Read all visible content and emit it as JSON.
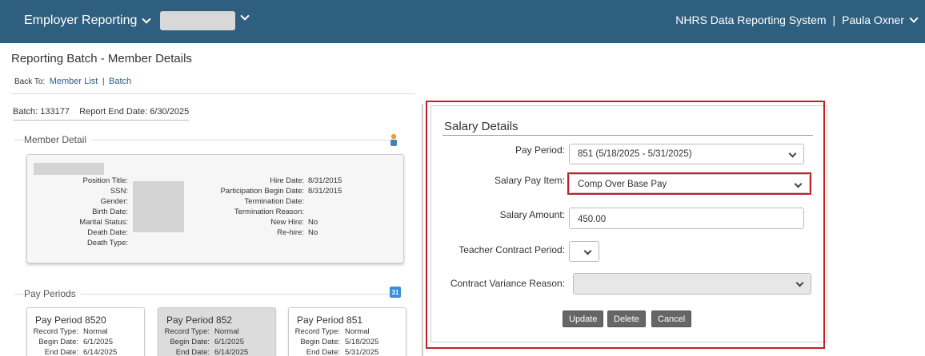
{
  "header": {
    "menu_label": "Employer Reporting",
    "system_name": "NHRS Data Reporting System",
    "separator": "|",
    "user_name": "Paula Oxner"
  },
  "page": {
    "title": "Reporting Batch - Member Details",
    "back_to_label": "Back To:",
    "back_member_list": "Member List",
    "back_sep": "|",
    "back_batch": "Batch"
  },
  "batch": {
    "batch_label": "Batch:",
    "batch_number": "133177",
    "report_end_label": "Report End Date:",
    "report_end_date": "6/30/2025"
  },
  "member_detail": {
    "heading": "Member Detail",
    "left_fields": [
      {
        "label": "Position Title:",
        "value": ""
      },
      {
        "label": "SSN:",
        "value": ""
      },
      {
        "label": "Gender:",
        "value": ""
      },
      {
        "label": "Birth Date:",
        "value": ""
      },
      {
        "label": "Marital Status:",
        "value": ""
      },
      {
        "label": "Death Date:",
        "value": ""
      },
      {
        "label": "Death Type:",
        "value": ""
      }
    ],
    "right_fields": [
      {
        "label": "Hire Date:",
        "value": "8/31/2015"
      },
      {
        "label": "Participation Begin Date:",
        "value": "8/31/2015"
      },
      {
        "label": "Termination Date:",
        "value": ""
      },
      {
        "label": "Termination Reason:",
        "value": ""
      },
      {
        "label": "New Hire:",
        "value": "No"
      },
      {
        "label": "Re-hire:",
        "value": "No"
      }
    ]
  },
  "pay_periods": {
    "heading": "Pay Periods",
    "calendar_glyph": "31",
    "cards": [
      {
        "title": "Pay Period 8520",
        "record_type_label": "Record Type:",
        "record_type": "Normal",
        "begin_label": "Begin Date:",
        "begin": "6/1/2025",
        "end_label": "End Date:",
        "end": "6/14/2025",
        "selected": false
      },
      {
        "title": "Pay Period 852",
        "record_type_label": "Record Type:",
        "record_type": "Normal",
        "begin_label": "Begin Date:",
        "begin": "6/1/2025",
        "end_label": "End Date:",
        "end": "6/14/2025",
        "selected": true
      },
      {
        "title": "Pay Period 851",
        "record_type_label": "Record Type:",
        "record_type": "Normal",
        "begin_label": "Begin Date:",
        "begin": "5/18/2025",
        "end_label": "End Date:",
        "end": "5/31/2025",
        "selected": false
      }
    ]
  },
  "salary_details": {
    "heading": "Salary Details",
    "pay_period_label": "Pay Period:",
    "pay_period_value": "851 (5/18/2025 - 5/31/2025)",
    "salary_pay_item_label": "Salary Pay Item:",
    "salary_pay_item_value": "Comp Over Base Pay",
    "salary_amount_label": "Salary Amount:",
    "salary_amount_value": "450.00",
    "teacher_contract_label": "Teacher Contract Period:",
    "teacher_contract_value": "",
    "contract_variance_label": "Contract Variance Reason:",
    "contract_variance_value": "",
    "update_label": "Update",
    "delete_label": "Delete",
    "cancel_label": "Cancel"
  },
  "colors": {
    "header_bg": "#2f5f7e",
    "highlight_red": "#c0202a",
    "link_blue": "#2a5d8c",
    "button_gray": "#666666"
  }
}
